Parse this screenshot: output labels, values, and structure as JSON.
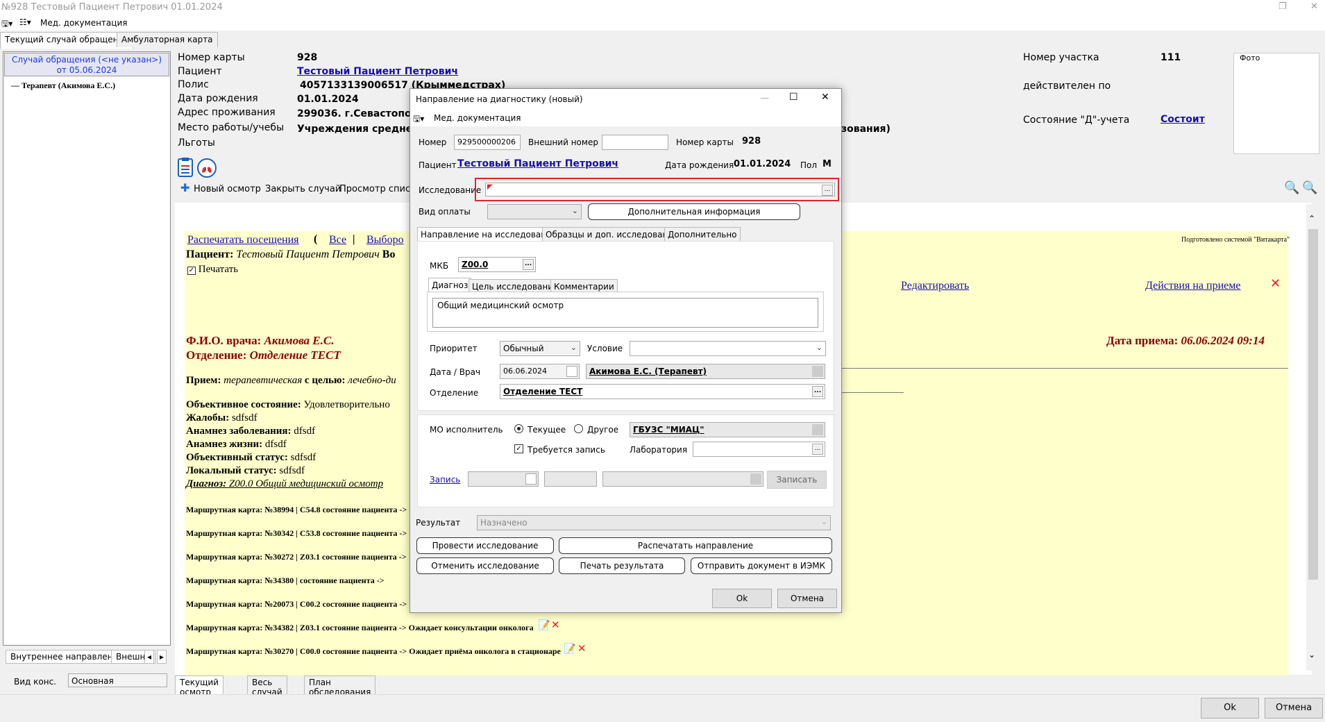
{
  "window": {
    "title": "№928 Тестовый Пациент Петрович 01.01.2024",
    "menu_label": "Мед. документация"
  },
  "top_tabs": [
    "Текущий случай обращения",
    "Амбулаторная карта"
  ],
  "left_panel": {
    "case_line1": "Случай обращения (<не указан>)",
    "case_line2": "от 05.06.2024",
    "tree_item": "Терапевт (Акимова Е.С.)",
    "tabs": [
      "Внутреннее направление",
      "Внешне"
    ],
    "vid_kons_label": "Вид конс.",
    "vid_kons_value": "Основная"
  },
  "patient": {
    "card_label": "Номер карты",
    "card_value": "928",
    "patient_label": "Пациент",
    "patient_value": "Тестовый Пациент Петрович",
    "polis_label": "Полис",
    "polis_value": "4057133139006517 (Крыммедстрах)",
    "dob_label": "Дата рождения",
    "dob_value": "01.01.2024",
    "address_label": "Адрес проживания",
    "address_value": "299036. г.Севастополь",
    "work_label": "Место работы/учебы",
    "work_value": "Учреждения среднег",
    "work_value_tail": "зования)",
    "benefits_label": "Льготы",
    "area_label": "Номер участка",
    "area_value": "111",
    "valid_label": "действителен по",
    "d_label": "Состояние \"Д\"-учета",
    "d_value": "Состоит",
    "foto_label": "Фото"
  },
  "toolbar": {
    "new_exam": "Новый осмотр",
    "close_case": "Закрыть случай",
    "view_list": "Просмотр список"
  },
  "document": {
    "print_visits": "Распечатать посещения",
    "paren": "(",
    "all": "Все",
    "sep": "|",
    "selected": "Выборо",
    "prepared_by": "Подготовлено системой \"Витакарта\"",
    "patient_prefix": "Пациент:",
    "patient_name": "Тестовый Пациент Петрович",
    "patient_tail": "Во",
    "print_checkbox": "Печатать",
    "edit_link": "Редактировать",
    "actions_link": "Действия на приеме",
    "doctor_prefix": "Ф.И.О. врача:",
    "doctor_name": "Акимова Е.С.",
    "department_prefix": "Отделение:",
    "department_name": "Отделение ТЕСТ",
    "visit_date_prefix": "Дата приема:",
    "visit_date": "06.06.2024 09:14",
    "reception_prefix": "Прием:",
    "reception_type": "терапевтическая",
    "reception_mid": "с целью:",
    "reception_goal": "лечебно-ди",
    "objective_label": "Объективное состояние:",
    "objective_value": "Удовлетворительно",
    "complaints_label": "Жалобы:",
    "complaints_value": "sdfsdf",
    "anamnesis_label": "Анамнез заболевания:",
    "anamnesis_value": "dfsdf",
    "life_label": "Анамнез жизни:",
    "life_value": "dfsdf",
    "status_label": "Объективный статус:",
    "status_value": "sdfsdf",
    "local_label": "Локальный статус:",
    "local_value": "sdfsdf",
    "diagnosis_label": "Диагноз:",
    "diagnosis_value": "Z00.0 Общий медицинский осмотр",
    "route_cards": [
      "Маршрутная карта: №38994 | C54.8 состояние пациента ->",
      "Маршрутная карта: №30342 | C53.8 состояние пациента ->",
      "Маршрутная карта: №30272 | Z03.1 состояние пациента ->",
      "Маршрутная карта: №34380 | состояние пациента ->",
      "Маршрутная карта: №20073 | C00.2 состояние пациента ->",
      "Маршрутная карта: №34382 | Z03.1 состояние пациента -> Ожидает консультации онколога",
      "Маршрутная карта: №30270 | C00.0 состояние пациента -> Ожидает приёма онколога в стационаре"
    ]
  },
  "bottom_tabs": [
    "Текущий осмотр",
    "Весь случай",
    "План обследования"
  ],
  "bottom_buttons": {
    "ok": "Ok",
    "cancel": "Отмена"
  },
  "dialog": {
    "title": "Направление на диагностику (новый)",
    "menu_label": "Мед. документация",
    "number_label": "Номер",
    "number_value": "929500000206",
    "ext_number_label": "Внешний номер",
    "ext_number_value": "",
    "card_label": "Номер карты",
    "card_value": "928",
    "patient_label": "Пациент",
    "patient_value": "Тестовый Пациент Петрович",
    "dob_label": "Дата рождения",
    "dob_value": "01.01.2024",
    "sex_label": "Пол",
    "sex_value": "М",
    "research_label": "Исследование",
    "research_value": "",
    "payment_label": "Вид оплаты",
    "payment_value": "",
    "extra_info_button": "Дополнительная информация",
    "tabs": [
      "Направление на исследование",
      "Образцы и доп. исследования",
      "Дополнительно"
    ],
    "mkb_label": "МКБ",
    "mkb_value": "Z00.0",
    "inner_tabs": [
      "Диагноз",
      "Цель исследования",
      "Комментарии"
    ],
    "diagnosis_text": "Общий медицинский осмотр",
    "priority_label": "Приоритет",
    "priority_value": "Обычный",
    "condition_label": "Условие",
    "condition_value": "",
    "date_doctor_label": "Дата / Врач",
    "date_value": "06.06.2024",
    "doctor_value": "Акимова Е.С. (Терапевт)",
    "department_label": "Отделение",
    "department_value": "Отделение ТЕСТ",
    "mo_label": "МО исполнитель",
    "radio_current": "Текущее",
    "radio_other": "Другое",
    "mo_value": "ГБУЗС \"МИАЦ\"",
    "need_record_label": "Требуется запись",
    "lab_label": "Лаборатория",
    "lab_value": "",
    "record_link": "Запись",
    "write_button": "Записать",
    "result_label": "Результат",
    "result_value": "Назначено",
    "btn_conduct": "Провести исследование",
    "btn_print_direction": "Распечатать направление",
    "btn_cancel_research": "Отменить исследование",
    "btn_print_result": "Печать результата",
    "btn_send_iemk": "Отправить документ в ИЭМК",
    "ok": "Ok",
    "cancel": "Отмена"
  },
  "colors": {
    "yellow_doc": "#ffffcc",
    "link_blue": "#1a0dab",
    "dark_red": "#8b0000",
    "highlight_red": "#e0242d"
  }
}
